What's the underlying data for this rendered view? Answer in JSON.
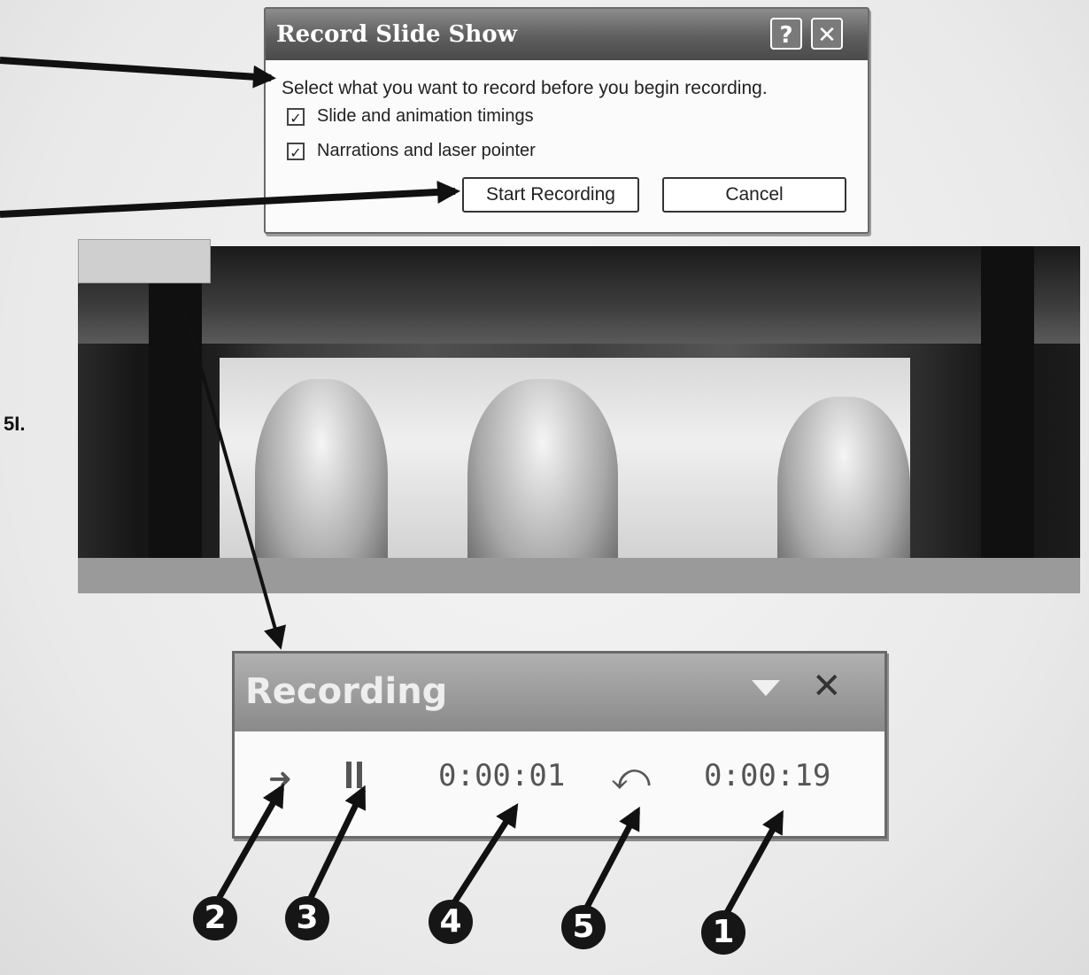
{
  "dialog": {
    "title": "Record Slide Show",
    "help_glyph": "?",
    "close_glyph": "✕",
    "prompt": "Select what you want to record before you begin recording.",
    "options": [
      {
        "label": "Slide and animation timings",
        "checked": true
      },
      {
        "label": "Narrations and laser pointer",
        "checked": true
      }
    ],
    "check_glyph": "✓",
    "start_button": "Start Recording",
    "cancel_button": "Cancel"
  },
  "margin_mark": "5I.",
  "recording_toolbar": {
    "title": "Recording",
    "close_glyph": "✕",
    "next_glyph": "➜",
    "repeat_glyph": "⤺",
    "slide_time": "0:00:01",
    "total_time": "0:00:19"
  },
  "callouts": [
    "2",
    "3",
    "4",
    "5",
    "1"
  ],
  "colors": {
    "dialog_titlebar": "#5e5e5e",
    "toolbar_titlebar": "#8a8a8a",
    "badge": "#161616"
  }
}
